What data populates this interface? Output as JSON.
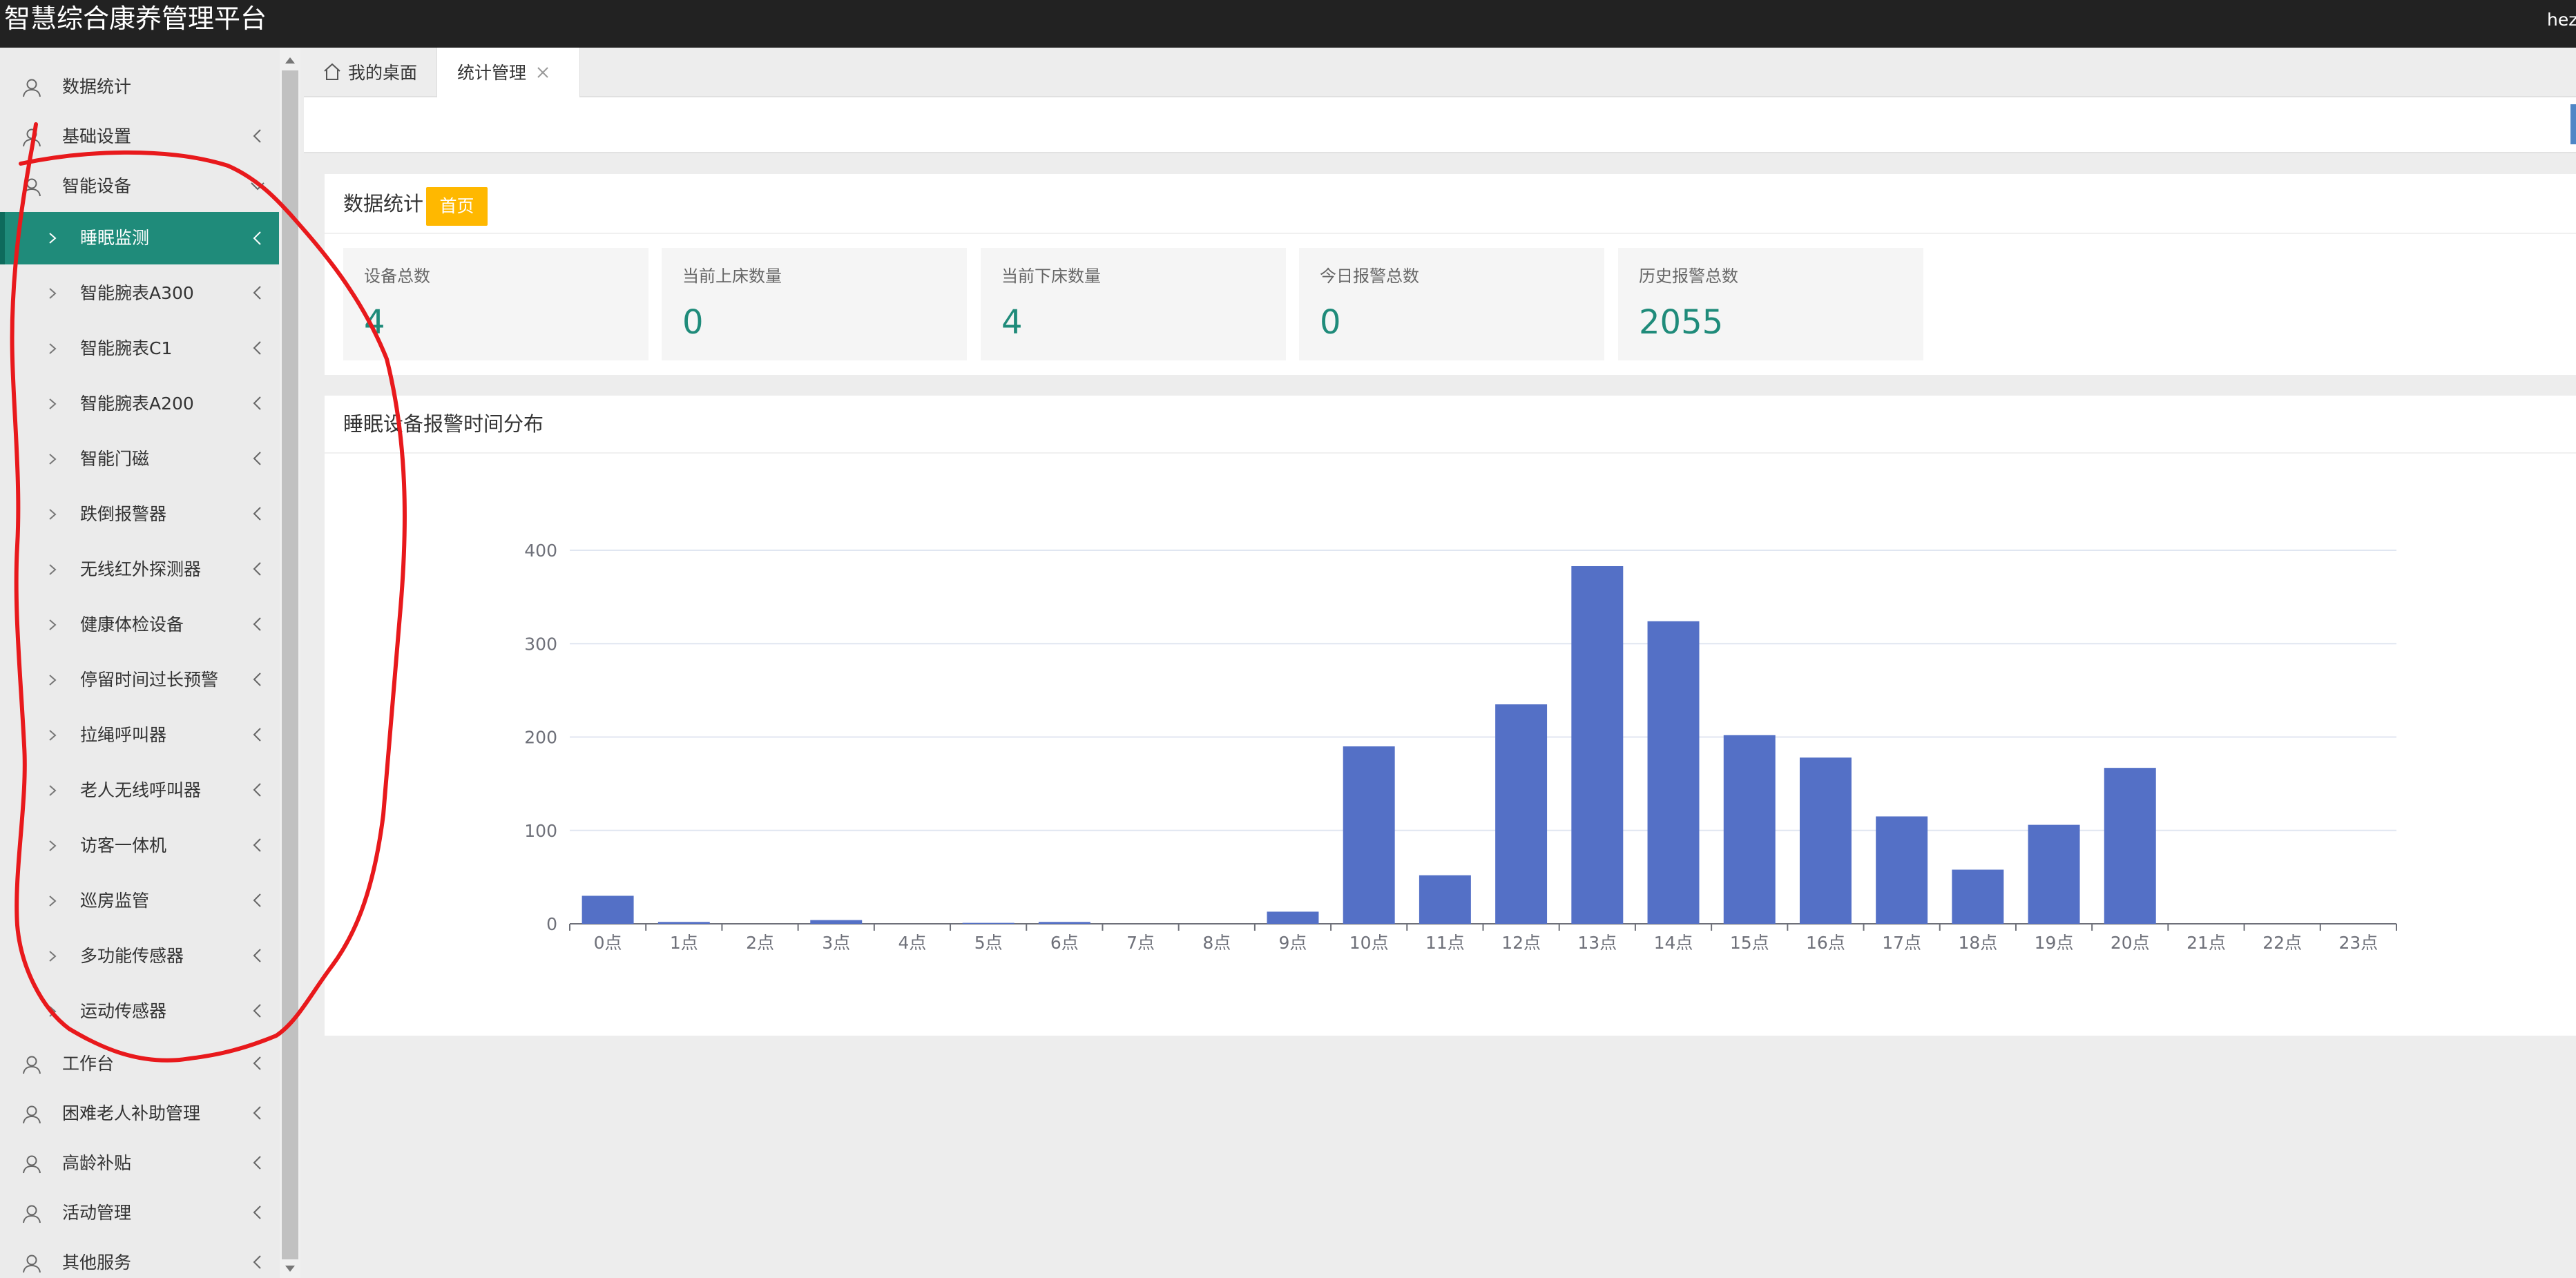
{
  "header": {
    "app_title": "智慧综合康养管理平台",
    "user": "hez"
  },
  "sidebar": {
    "items_top": [
      {
        "label": "数据统计",
        "has_chevron": false
      },
      {
        "label": "基础设置",
        "has_chevron": true
      },
      {
        "label": "智能设备",
        "has_chevron": true
      }
    ],
    "subitems": [
      {
        "label": "睡眠监测",
        "active": true
      },
      {
        "label": "智能腕表A300"
      },
      {
        "label": "智能腕表C1"
      },
      {
        "label": "智能腕表A200"
      },
      {
        "label": "智能门磁"
      },
      {
        "label": "跌倒报警器"
      },
      {
        "label": "无线红外探测器"
      },
      {
        "label": "健康体检设备"
      },
      {
        "label": "停留时间过长预警"
      },
      {
        "label": "拉绳呼叫器"
      },
      {
        "label": "老人无线呼叫器"
      },
      {
        "label": "访客一体机"
      },
      {
        "label": "巡房监管"
      },
      {
        "label": "多功能传感器"
      },
      {
        "label": "运动传感器"
      }
    ],
    "items_bottom": [
      {
        "label": "工作台"
      },
      {
        "label": "困难老人补助管理"
      },
      {
        "label": "高龄补贴"
      },
      {
        "label": "活动管理"
      },
      {
        "label": "其他服务"
      }
    ]
  },
  "tabs": [
    {
      "label": "我的桌面",
      "icon": "home-icon"
    },
    {
      "label": "统计管理",
      "icon": "close-icon",
      "active": true
    }
  ],
  "stats_card": {
    "title": "数据统计",
    "badge": "首页",
    "stats": [
      {
        "label": "设备总数",
        "value": "4"
      },
      {
        "label": "当前上床数量",
        "value": "0"
      },
      {
        "label": "当前下床数量",
        "value": "4"
      },
      {
        "label": "今日报警总数",
        "value": "0"
      },
      {
        "label": "历史报警总数",
        "value": "2055"
      }
    ]
  },
  "chart_card": {
    "title": "睡眠设备报警时间分布"
  },
  "colors": {
    "accent": "#1f8b7a",
    "badge": "#ffb800",
    "bar": "#5470c6",
    "annotation": "#e8191c"
  },
  "chart_data": {
    "type": "bar",
    "categories": [
      "0点",
      "1点",
      "2点",
      "3点",
      "4点",
      "5点",
      "6点",
      "7点",
      "8点",
      "9点",
      "10点",
      "11点",
      "12点",
      "13点",
      "14点",
      "15点",
      "16点",
      "17点",
      "18点",
      "19点",
      "20点",
      "21点",
      "22点",
      "23点"
    ],
    "values": [
      30,
      2,
      0,
      4,
      0,
      1,
      2,
      0,
      0,
      13,
      190,
      52,
      235,
      383,
      324,
      202,
      178,
      115,
      58,
      106,
      167,
      0,
      0,
      0
    ],
    "yticks": [
      0,
      100,
      200,
      300,
      400
    ],
    "ylim": [
      0,
      400
    ],
    "title": "",
    "xlabel": "",
    "ylabel": ""
  }
}
